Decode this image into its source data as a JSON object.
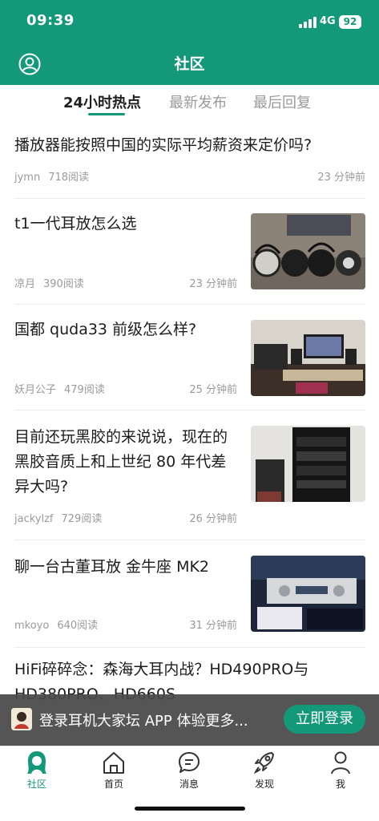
{
  "status_bar": {
    "time": "09:39",
    "network": "4G",
    "battery": "92"
  },
  "nav": {
    "title": "社区",
    "avatar_icon": "user-circle-icon"
  },
  "tabs": [
    {
      "label": "24小时热点",
      "active": true
    },
    {
      "label": "最新发布",
      "active": false
    },
    {
      "label": "最后回复",
      "active": false
    }
  ],
  "posts": [
    {
      "title": "播放器能按照中国的实际平均薪资来定价吗?",
      "author": "jymn",
      "reads": "718阅读",
      "time": "23 分钟前"
    },
    {
      "title": "t1一代耳放怎么选",
      "author": "凉月",
      "reads": "390阅读",
      "time": "23 分钟前"
    },
    {
      "title": "国都 quda33 前级怎么样?",
      "author": "妖月公子",
      "reads": "479阅读",
      "time": "25 分钟前"
    },
    {
      "title": "目前还玩黑胶的来说说，现在的黑胶音质上和上世纪 80 年代差异大吗?",
      "author": "jackylzf",
      "reads": "729阅读",
      "time": "26 分钟前"
    },
    {
      "title": "聊一台古董耳放 金牛座 MK2",
      "author": "mkoyo",
      "reads": "640阅读",
      "time": "31 分钟前"
    },
    {
      "title": "HiFi碎碎念：森海大耳内战？HD490PRO与HD380PRO、HD660S"
    }
  ],
  "banner": {
    "text": "登录耳机大家坛 APP 体验更多...",
    "button": "立即登录"
  },
  "tabbar": [
    {
      "label": "社区",
      "icon": "community-icon",
      "active": true
    },
    {
      "label": "首页",
      "icon": "home-icon",
      "active": false
    },
    {
      "label": "消息",
      "icon": "message-icon",
      "active": false
    },
    {
      "label": "发现",
      "icon": "rocket-icon",
      "active": false
    },
    {
      "label": "我",
      "icon": "person-icon",
      "active": false
    }
  ],
  "colors": {
    "brand": "#14987a",
    "muted_text": "#9a9a9a"
  }
}
